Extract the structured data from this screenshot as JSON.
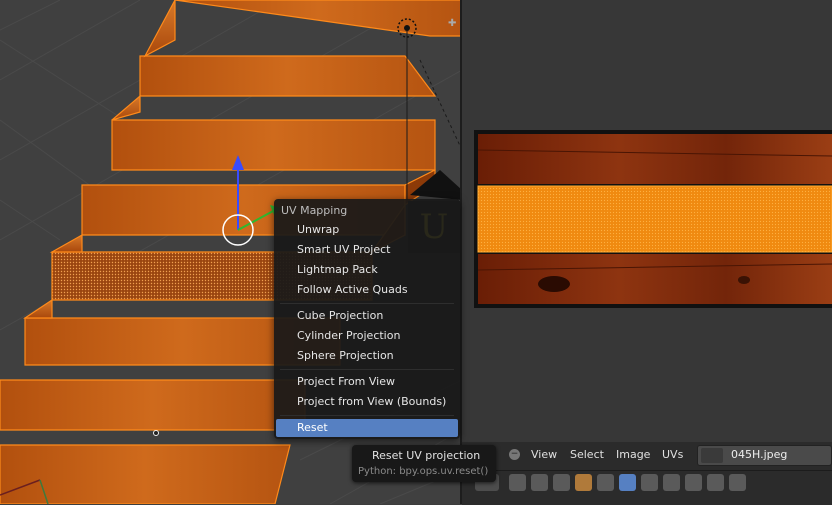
{
  "uv_menu": {
    "title": "UV Mapping",
    "items": [
      {
        "label": "Unwrap"
      },
      {
        "label": "Smart UV Project"
      },
      {
        "label": "Lightmap Pack"
      },
      {
        "label": "Follow Active Quads"
      },
      {
        "label": "Cube Projection"
      },
      {
        "label": "Cylinder Projection"
      },
      {
        "label": "Sphere Projection"
      },
      {
        "label": "Project From View"
      },
      {
        "label": "Project from View (Bounds)"
      },
      {
        "label": "Reset",
        "active": true
      }
    ]
  },
  "key_hint": "U",
  "tooltip": {
    "title": "Reset UV projection",
    "python": "Python: bpy.ops.uv.reset()"
  },
  "image_editor": {
    "menus": [
      "View",
      "Select",
      "Image",
      "UVs"
    ],
    "image_name": "045H.jpeg"
  },
  "colors": {
    "menu_highlight": "#5680c2",
    "selection_orange": "#ff8a1a",
    "key_hint": "#f3f02a"
  }
}
